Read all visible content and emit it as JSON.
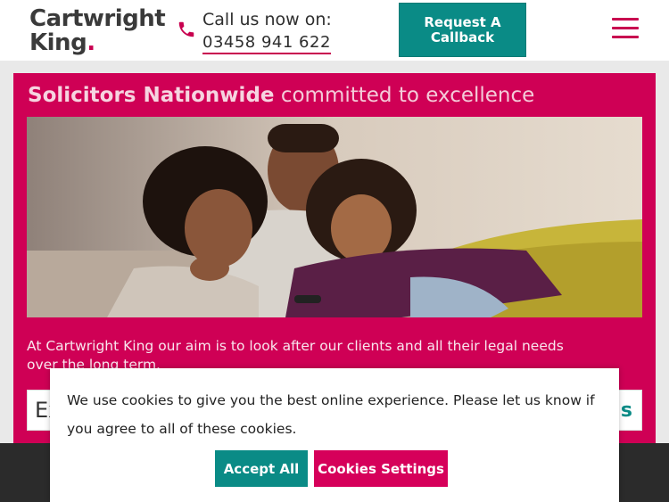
{
  "header": {
    "logo_line1": "Cartwright",
    "logo_line2": "King",
    "logo_dot": ".",
    "call_label": "Call us now on:",
    "phone_number": "03458 941 622",
    "callback_label": "Request A Callback",
    "phone_icon": "phone-icon",
    "menu_icon": "hamburger-menu-icon"
  },
  "panel": {
    "headline_bold": "Solicitors Nationwide",
    "headline_light": "committed to excellence",
    "hero_alt": "family-photo",
    "intro": "At Cartwright King our aim is to look after our clients and all their legal needs over the long term.",
    "search_partial_start": "Ex",
    "search_partial_end": "s"
  },
  "cookie_banner": {
    "message": "We use cookies to give you the best online experience. Please let us know if you agree to all of these cookies.",
    "accept_label": "Accept All",
    "settings_label": "Cookies Settings"
  },
  "colors": {
    "brand_pink": "#cf0055",
    "brand_teal": "#0a8b86",
    "dark": "#2b2b2b"
  }
}
